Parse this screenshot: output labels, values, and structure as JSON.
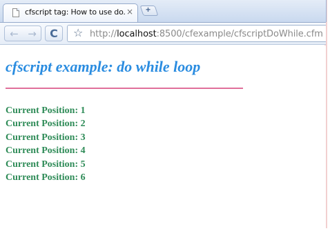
{
  "browser": {
    "tab": {
      "title": "cfscript tag: How to use do...",
      "close_glyph": "×",
      "favicon": "page-icon"
    },
    "new_tab_glyph": "+",
    "toolbar": {
      "back_glyph": "←",
      "forward_glyph": "→",
      "reload_glyph": "C",
      "star_glyph": "☆",
      "url_prefix": "http://",
      "url_host": "localhost",
      "url_rest": ":8500/cfexample/cfscriptDoWhile.cfm"
    }
  },
  "page": {
    "heading": "cfscript example: do while loop",
    "positions": [
      "Current Position: 1",
      "Current Position: 2",
      "Current Position: 3",
      "Current Position: 4",
      "Current Position: 5",
      "Current Position: 6"
    ],
    "colors": {
      "heading": "#2a8ce0",
      "divider": "#e06f9a",
      "positions": "#2e8b57"
    }
  }
}
